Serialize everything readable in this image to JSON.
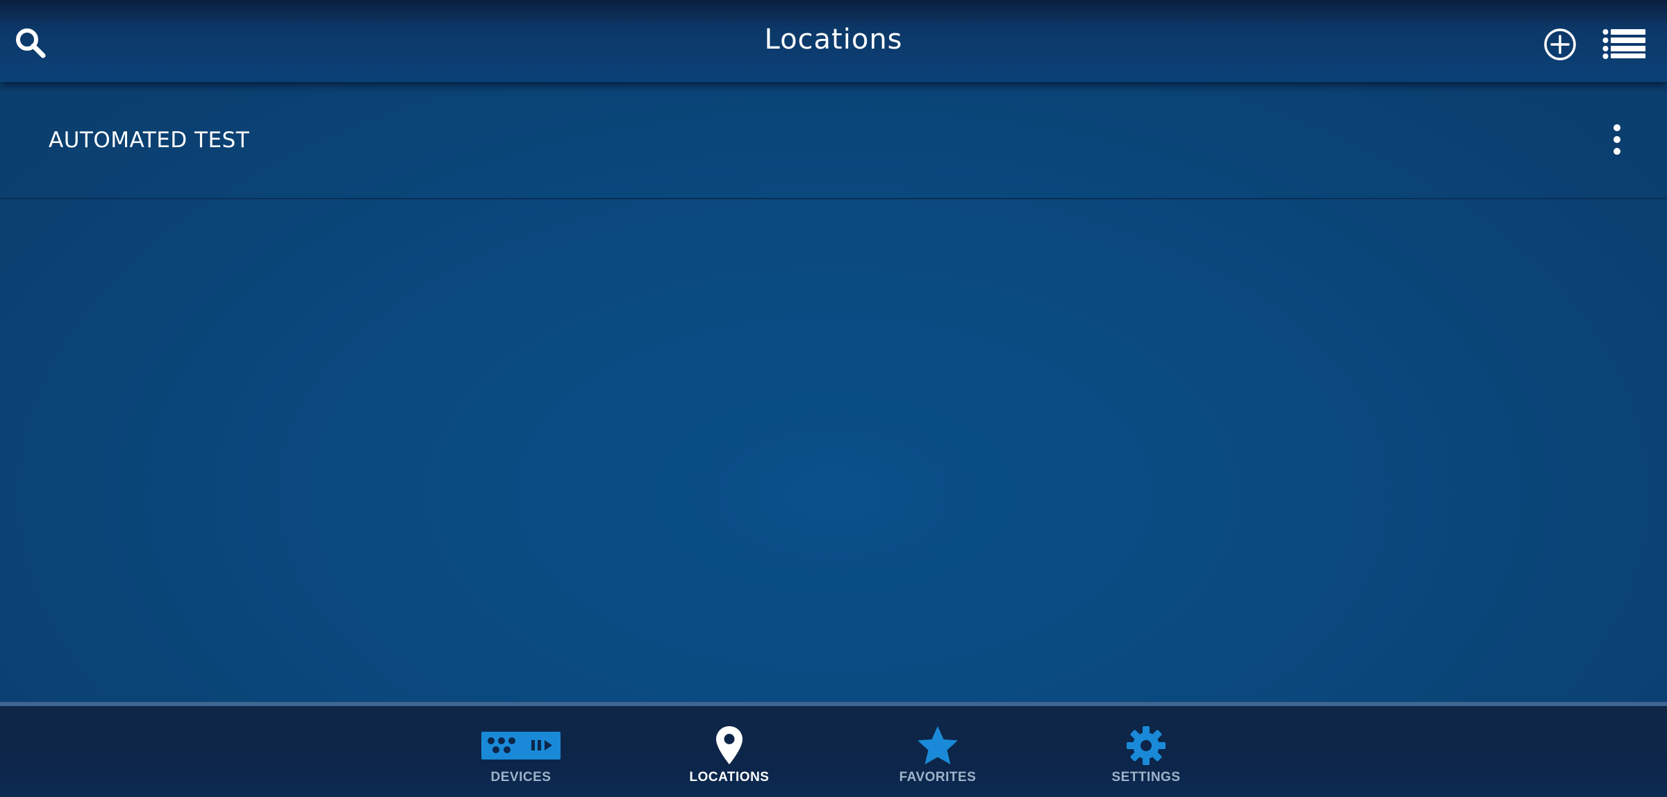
{
  "header": {
    "title": "Locations",
    "search_icon": "search-icon",
    "add_icon": "add-circle-icon",
    "list_icon": "list-view-icon"
  },
  "locations": [
    {
      "name": "AUTOMATED TEST",
      "menu_icon": "more-vertical-icon"
    }
  ],
  "bottom_nav": {
    "items": [
      {
        "label": "DEVICES",
        "icon": "devices-icon",
        "active": false
      },
      {
        "label": "LOCATIONS",
        "icon": "location-pin-icon",
        "active": true
      },
      {
        "label": "FAVORITES",
        "icon": "star-icon",
        "active": false
      },
      {
        "label": "SETTINGS",
        "icon": "gear-icon",
        "active": false
      }
    ]
  },
  "colors": {
    "background": "#0a4a80",
    "top_bar": "#0b4178",
    "nav_background": "#0c2549",
    "nav_icon_accent": "#1a8ad8",
    "inactive_label": "#9fb4cb",
    "active_label": "#ffffff"
  }
}
